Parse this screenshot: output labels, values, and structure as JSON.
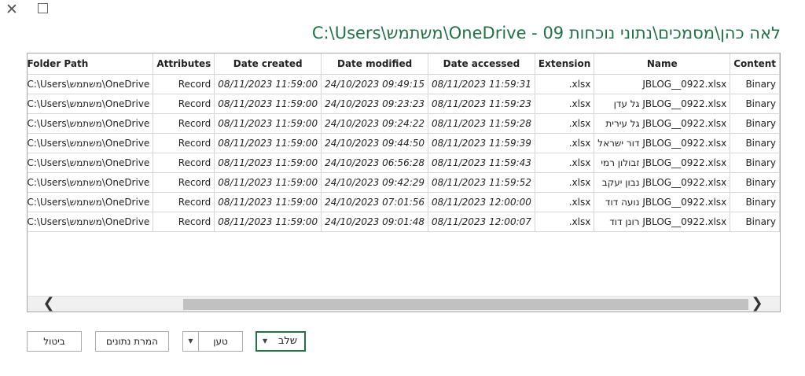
{
  "window": {
    "close_glyph": "✕",
    "maximize_label": ""
  },
  "title": "C:\\Users\\משתמש\\OneDrive - לאה כהן\\מסמכים\\נתוני נוכחות 09",
  "table": {
    "columns": [
      "Content",
      "Name",
      "Extension",
      "Date accessed",
      "Date modified",
      "Date created",
      "Attributes",
      "Folder Path"
    ],
    "rows": [
      {
        "content": "Binary",
        "name": "JBLOG__0922.xlsx",
        "extension": ".xlsx",
        "accessed": "08/11/2023 11:59:31",
        "modified": "24/10/2023 09:49:15",
        "created": "08/11/2023 11:59:00",
        "attributes": "Record",
        "path": "C:\\Users\\משתמש\\OneDrive"
      },
      {
        "content": "Binary",
        "name": "גל עדן JBLOG__0922.xlsx",
        "extension": ".xlsx",
        "accessed": "08/11/2023 11:59:23",
        "modified": "24/10/2023 09:23:23",
        "created": "08/11/2023 11:59:00",
        "attributes": "Record",
        "path": "C:\\Users\\משתמש\\OneDrive"
      },
      {
        "content": "Binary",
        "name": "גל עירית JBLOG__0922.xlsx",
        "extension": ".xlsx",
        "accessed": "08/11/2023 11:59:28",
        "modified": "24/10/2023 09:24:22",
        "created": "08/11/2023 11:59:00",
        "attributes": "Record",
        "path": "C:\\Users\\משתמש\\OneDrive"
      },
      {
        "content": "Binary",
        "name": "דור ישראל JBLOG__0922.xlsx",
        "extension": ".xlsx",
        "accessed": "08/11/2023 11:59:39",
        "modified": "24/10/2023 09:44:50",
        "created": "08/11/2023 11:59:00",
        "attributes": "Record",
        "path": "C:\\Users\\משתמש\\OneDrive"
      },
      {
        "content": "Binary",
        "name": "זבולון רמי JBLOG__0922.xlsx",
        "extension": ".xlsx",
        "accessed": "08/11/2023 11:59:43",
        "modified": "24/10/2023 06:56:28",
        "created": "08/11/2023 11:59:00",
        "attributes": "Record",
        "path": "C:\\Users\\משתמש\\OneDrive"
      },
      {
        "content": "Binary",
        "name": "נבון יעקב JBLOG__0922.xlsx",
        "extension": ".xlsx",
        "accessed": "08/11/2023 11:59:52",
        "modified": "24/10/2023 09:42:29",
        "created": "08/11/2023 11:59:00",
        "attributes": "Record",
        "path": "C:\\Users\\משתמש\\OneDrive"
      },
      {
        "content": "Binary",
        "name": "נועה דוד JBLOG__0922.xlsx",
        "extension": ".xlsx",
        "accessed": "08/11/2023 12:00:00",
        "modified": "24/10/2023 07:01:56",
        "created": "08/11/2023 11:59:00",
        "attributes": "Record",
        "path": "C:\\Users\\משתמש\\OneDrive"
      },
      {
        "content": "Binary",
        "name": "רונן דוד JBLOG__0922.xlsx",
        "extension": ".xlsx",
        "accessed": "08/11/2023 12:00:07",
        "modified": "24/10/2023 09:01:48",
        "created": "08/11/2023 11:59:00",
        "attributes": "Record",
        "path": "C:\\Users\\משתמש\\OneDrive"
      }
    ]
  },
  "scroll": {
    "left_glyph": "❮",
    "right_glyph": "❯"
  },
  "buttons": {
    "combine": "שלב",
    "combine_caret": "▼",
    "load": "טען",
    "load_caret": "▼",
    "transform": "המרת נתונים",
    "cancel": "ביטול"
  }
}
